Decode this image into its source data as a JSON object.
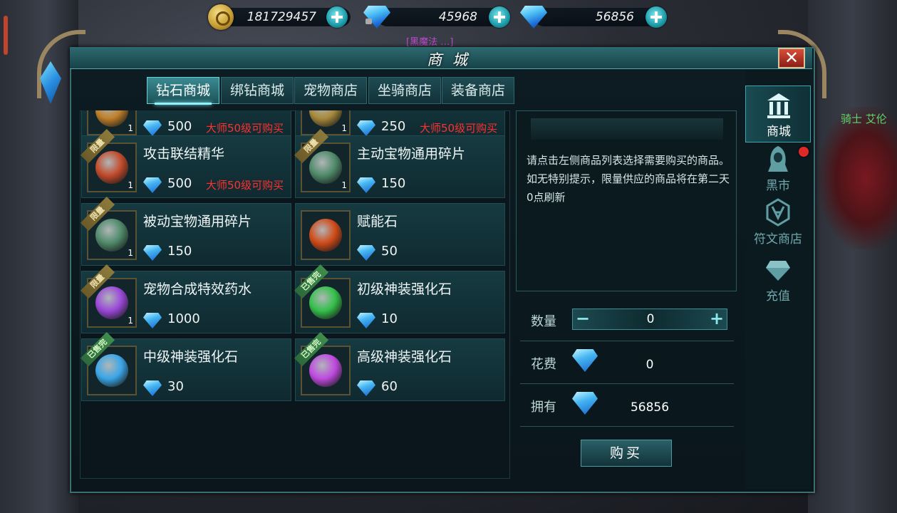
{
  "currency": {
    "gold": "181729457",
    "bound_diamond": "45968",
    "diamond": "56856"
  },
  "background": {
    "top_text": "[黑魔法 …]",
    "right_text": "骑士 艾伦"
  },
  "window": {
    "title": "商 城",
    "close_label": "✕"
  },
  "tabs": [
    {
      "label": "钻石商城",
      "active": true
    },
    {
      "label": "绑钻商城",
      "active": false
    },
    {
      "label": "宠物商店",
      "active": false
    },
    {
      "label": "坐骑商店",
      "active": false
    },
    {
      "label": "装备商店",
      "active": false
    }
  ],
  "items": [
    {
      "name": "",
      "qty": "1",
      "price": "500",
      "req": "大师50级可购买",
      "badge": "",
      "icon": "partial-item-icon",
      "color": "#c0802a"
    },
    {
      "name": "",
      "qty": "1",
      "price": "250",
      "req": "大师50级可购买",
      "badge": "",
      "icon": "partial-item-icon",
      "color": "#a88a3a"
    },
    {
      "name": "攻击联结精华",
      "qty": "1",
      "price": "500",
      "req": "大师50级可购买",
      "badge": "限量",
      "icon": "attack-essence-icon",
      "color": "#c24a2a"
    },
    {
      "name": "主动宝物通用碎片",
      "qty": "1",
      "price": "150",
      "req": "",
      "badge": "限量",
      "icon": "jade-fragment-icon",
      "color": "#4f8a6a"
    },
    {
      "name": "被动宝物通用碎片",
      "qty": "1",
      "price": "150",
      "req": "",
      "badge": "限量",
      "icon": "jade-fragment-icon",
      "color": "#4f8a6a"
    },
    {
      "name": "赋能石",
      "qty": "",
      "price": "50",
      "req": "",
      "badge": "",
      "icon": "empower-stone-icon",
      "color": "#d04a18"
    },
    {
      "name": "宠物合成特效药水",
      "qty": "1",
      "price": "1000",
      "req": "",
      "badge": "限量",
      "icon": "potion-icon",
      "color": "#9a48d8"
    },
    {
      "name": "初级神装强化石",
      "qty": "",
      "price": "10",
      "req": "",
      "badge": "已售完",
      "icon": "green-gem-icon",
      "color": "#34c04a"
    },
    {
      "name": "中级神装强化石",
      "qty": "",
      "price": "30",
      "req": "",
      "badge": "已售完",
      "icon": "blue-gem-icon",
      "color": "#3aa6e8"
    },
    {
      "name": "高级神装强化石",
      "qty": "",
      "price": "60",
      "req": "",
      "badge": "已售完",
      "icon": "purple-gem-icon",
      "color": "#c04ae0"
    }
  ],
  "info": {
    "text": "请点击左侧商品列表选择需要购买的商品。\n如无特别提示，限量供应的商品将在第二天0点刷新"
  },
  "purchase": {
    "qty_label": "数量",
    "qty_value": "0",
    "cost_label": "花费",
    "cost_value": "0",
    "own_label": "拥有",
    "own_value": "56856",
    "buy_label": "购买"
  },
  "side_nav": [
    {
      "label": "商城",
      "icon": "bank-icon",
      "active": true
    },
    {
      "label": "黑市",
      "icon": "hooded-figure-icon",
      "active": false
    },
    {
      "label": "符文商店",
      "icon": "rune-icon",
      "active": false
    },
    {
      "label": "充值",
      "icon": "diamond-icon",
      "active": false
    }
  ]
}
